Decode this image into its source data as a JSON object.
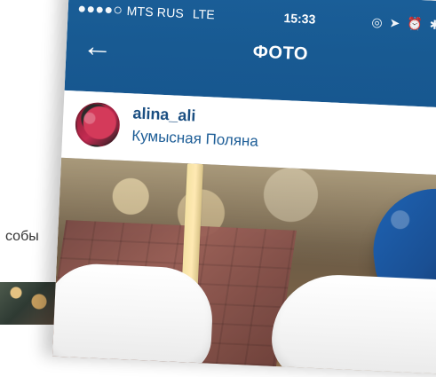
{
  "background": {
    "partial_text": "собы"
  },
  "phone": {
    "status": {
      "carrier": "MTS RUS",
      "network": "LTE",
      "time": "15:33"
    },
    "nav": {
      "title": "ФОТО"
    },
    "post": {
      "username": "alina_ali",
      "location": "Кумысная Поляна"
    }
  }
}
